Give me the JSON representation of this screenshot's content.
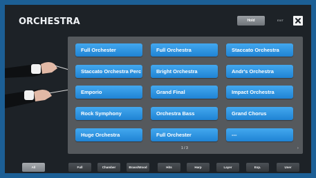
{
  "header": {
    "title": "ORCHESTRA",
    "hold_label": "Hold",
    "exit_label": "EXIT"
  },
  "presets": [
    "Full Orchester",
    "Full Orchestra",
    "Staccato Orchestra",
    "Staccato Orchestra Perc",
    "Bright Orchestra",
    "Andr's Orchestra",
    "Emporio",
    "Grand Final",
    "Impact Orchestra",
    "Rock Symphony",
    "Orchestra Bass",
    "Grand Chorus",
    "Huge Orchestra",
    "Full Orchester",
    "---"
  ],
  "pager": {
    "page": "1 / 3",
    "next": "›"
  },
  "categories": [
    "All",
    "Full",
    "Chamber",
    "Brass/Wood",
    "Hits",
    "Harp",
    "Layer",
    "Exp.",
    "User"
  ],
  "active_category": "All",
  "colors": {
    "accent": "#2b95e2",
    "frame": "#1c5f95",
    "background": "#1d2227"
  },
  "icons": {
    "close": "close-icon",
    "next": "chevron-right-icon"
  }
}
